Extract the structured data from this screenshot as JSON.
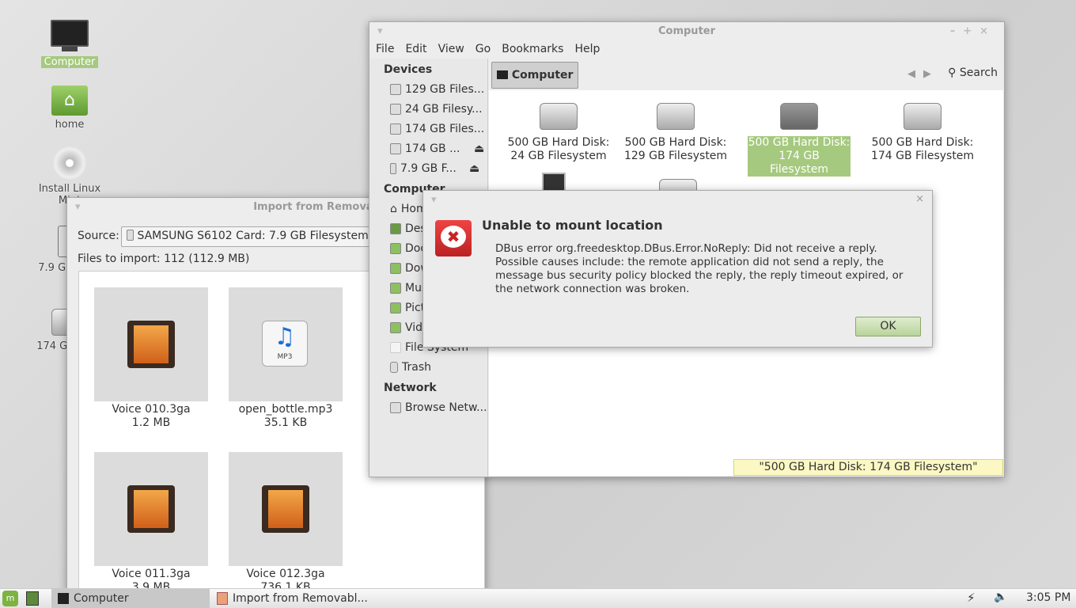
{
  "desktop": {
    "icons": [
      {
        "label": "Computer",
        "selected": true
      },
      {
        "label": "home"
      },
      {
        "label": "Install Linux Mint"
      },
      {
        "label": "7.9 GB F"
      },
      {
        "label": "174 GB F"
      }
    ]
  },
  "import_window": {
    "title": "Import from Removable Device",
    "source_label": "Source:",
    "source_value": "SAMSUNG S6102 Card: 7.9 GB Filesystem",
    "files_to_import": "Files to import: 112 (112.9 MB)",
    "files": [
      {
        "name": "Voice 010.3ga",
        "size": "1.2 MB",
        "type": "video"
      },
      {
        "name": "open_bottle.mp3",
        "size": "35.1 KB",
        "type": "mp3"
      },
      {
        "name": "Voice 011.3ga",
        "size": "3.9 MB",
        "type": "video"
      },
      {
        "name": "Voice 012.3ga",
        "size": "736.1 KB",
        "type": "video"
      }
    ],
    "mp3_badge": "MP3"
  },
  "computer_window": {
    "title": "Computer",
    "menu": [
      "File",
      "Edit",
      "View",
      "Go",
      "Bookmarks",
      "Help"
    ],
    "location": "Computer",
    "search": "Search",
    "sidebar": {
      "devices_header": "Devices",
      "devices": [
        "129 GB Files...",
        "24 GB Filesy...",
        "174 GB Files...",
        "174 GB ...",
        "7.9 GB F..."
      ],
      "computer_header": "Computer",
      "computer": [
        "Home",
        "Desktop",
        "Documents",
        "Downloads",
        "Music",
        "Pictures",
        "Videos",
        "File System",
        "Trash"
      ],
      "network_header": "Network",
      "network": [
        "Browse Netw..."
      ]
    },
    "items": [
      {
        "line1": "500 GB Hard Disk:",
        "line2": "24 GB Filesystem"
      },
      {
        "line1": "500 GB Hard Disk:",
        "line2": "129 GB Filesystem"
      },
      {
        "line1": "500 GB Hard Disk:",
        "line2": "174 GB Filesystem",
        "selected": true
      },
      {
        "line1": "500 GB Hard Disk:",
        "line2": "174 GB Filesystem"
      }
    ],
    "status": "\"500 GB Hard Disk: 174 GB Filesystem\" selected"
  },
  "dialog": {
    "title": "Unable to mount location",
    "message": "DBus error org.freedesktop.DBus.Error.NoReply: Did not receive a reply. Possible causes include: the remote application did not send a reply, the message bus security policy blocked the reply, the reply timeout expired, or the network connection was broken.",
    "ok": "OK"
  },
  "taskbar": {
    "tasks": [
      "Computer",
      "Import from Removabl..."
    ],
    "clock": "3:05 PM"
  },
  "colors": {
    "accent": "#a5c97e",
    "error": "#d8302a",
    "status_bg": "#fbf8c4"
  }
}
